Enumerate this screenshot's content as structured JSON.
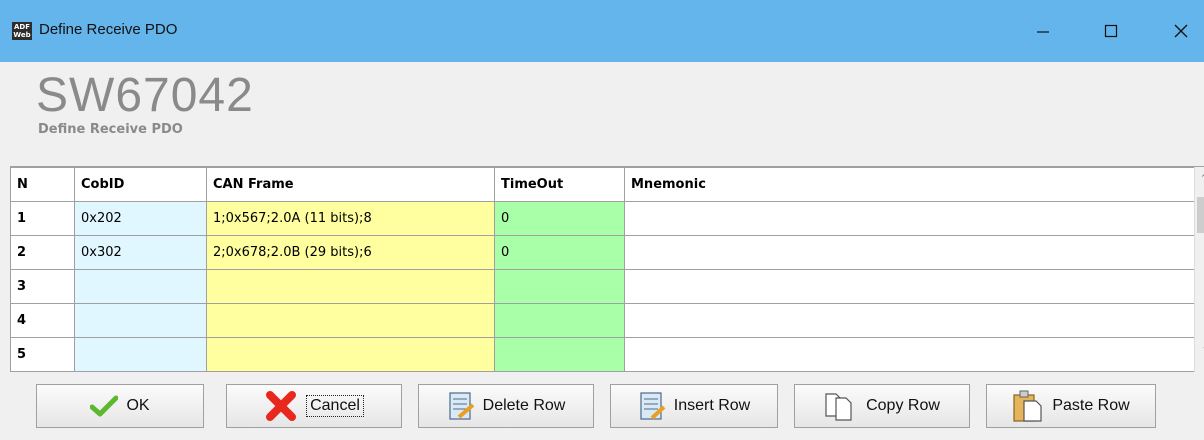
{
  "window": {
    "icon_text": "ADF\nWeb",
    "title": "Define Receive PDO"
  },
  "header": {
    "app_name": "SW67042",
    "subtitle": "Define Receive PDO"
  },
  "grid": {
    "columns": [
      "N",
      "CobID",
      "CAN Frame",
      "TimeOut",
      "Mnemonic"
    ],
    "rows": [
      {
        "n": "1",
        "cobid": "0x202",
        "can_frame": "1;0x567;2.0A (11 bits);8",
        "timeout": "0",
        "mnemonic": ""
      },
      {
        "n": "2",
        "cobid": "0x302",
        "can_frame": "2;0x678;2.0B (29 bits);6",
        "timeout": "0",
        "mnemonic": ""
      },
      {
        "n": "3",
        "cobid": "",
        "can_frame": "",
        "timeout": "",
        "mnemonic": ""
      },
      {
        "n": "4",
        "cobid": "",
        "can_frame": "",
        "timeout": "",
        "mnemonic": ""
      },
      {
        "n": "5",
        "cobid": "",
        "can_frame": "",
        "timeout": "",
        "mnemonic": ""
      }
    ]
  },
  "buttons": {
    "ok": "OK",
    "cancel": "Cancel",
    "delete_row": "Delete Row",
    "insert_row": "Insert Row",
    "copy_row": "Copy Row",
    "paste_row": "Paste Row"
  },
  "colors": {
    "titlebar": "#64b5ec",
    "cobid_column": "#e0f7ff",
    "can_frame_column": "#ffffa0",
    "timeout_column": "#a8ffa8"
  },
  "icons": [
    "app-logo-icon",
    "minimize-icon",
    "maximize-icon",
    "close-icon",
    "checkmark-icon",
    "red-x-icon",
    "delete-row-icon",
    "insert-row-icon",
    "copy-icon",
    "paste-icon"
  ]
}
